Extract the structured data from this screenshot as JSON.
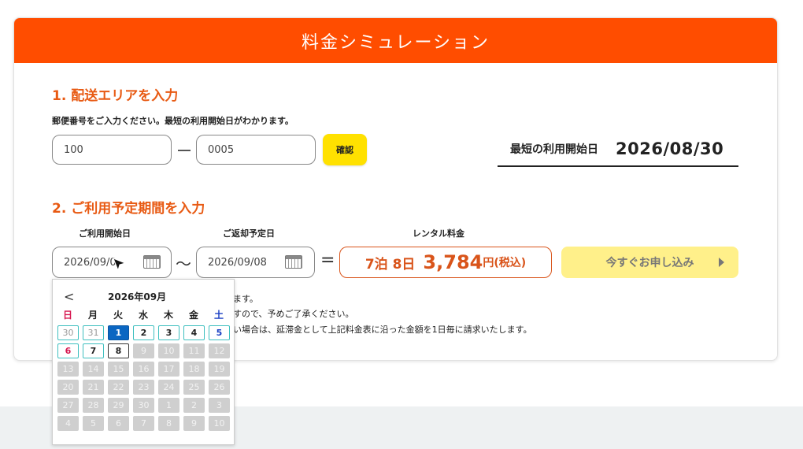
{
  "header": {
    "title": "料金シミュレーション"
  },
  "step1": {
    "title": "1. 配送エリアを入力",
    "note": "郵便番号をご入力ください。最短の利用開始日がわかります。",
    "zip_first": "100",
    "zip_second": "0005",
    "confirm_label": "確認",
    "earliest_label": "最短の利用開始日",
    "earliest_date": "2026/08/30"
  },
  "step2": {
    "title": "2. ご利用予定期間を入力",
    "start_label": "ご利用開始日",
    "return_label": "ご返却予定日",
    "fee_label": "レンタル料金",
    "start_date": "2026/09/0",
    "return_date": "2026/09/08",
    "tilde": "〜",
    "equals": "=",
    "price_nights": "7泊 8日",
    "price_amount": "3,784",
    "price_unit": "円(税込)",
    "apply_label": "今すぐお申し込み"
  },
  "notices": [
    "ます。",
    "すので、予めご了承ください。",
    "い場合は、延滞金として上記料金表に沿った金額を1日毎に請求いたします。"
  ],
  "calendar": {
    "prev": "<",
    "title": "2026年09月",
    "weekdays": [
      "日",
      "月",
      "火",
      "水",
      "木",
      "金",
      "土"
    ],
    "weeks": [
      [
        {
          "d": "30",
          "s": "outside"
        },
        {
          "d": "31",
          "s": "outside"
        },
        {
          "d": "1",
          "s": "selected"
        },
        {
          "d": "2",
          "s": "avail"
        },
        {
          "d": "3",
          "s": "avail"
        },
        {
          "d": "4",
          "s": "avail"
        },
        {
          "d": "5",
          "s": "avail"
        }
      ],
      [
        {
          "d": "6",
          "s": "avail"
        },
        {
          "d": "7",
          "s": "avail"
        },
        {
          "d": "8",
          "s": "end"
        },
        {
          "d": "9",
          "s": "disabled"
        },
        {
          "d": "10",
          "s": "disabled"
        },
        {
          "d": "11",
          "s": "disabled"
        },
        {
          "d": "12",
          "s": "disabled"
        }
      ],
      [
        {
          "d": "13",
          "s": "disabled"
        },
        {
          "d": "14",
          "s": "disabled"
        },
        {
          "d": "15",
          "s": "disabled"
        },
        {
          "d": "16",
          "s": "disabled"
        },
        {
          "d": "17",
          "s": "disabled"
        },
        {
          "d": "18",
          "s": "disabled"
        },
        {
          "d": "19",
          "s": "disabled"
        }
      ],
      [
        {
          "d": "20",
          "s": "disabled"
        },
        {
          "d": "21",
          "s": "disabled"
        },
        {
          "d": "22",
          "s": "disabled"
        },
        {
          "d": "23",
          "s": "disabled"
        },
        {
          "d": "24",
          "s": "disabled"
        },
        {
          "d": "25",
          "s": "disabled"
        },
        {
          "d": "26",
          "s": "disabled"
        }
      ],
      [
        {
          "d": "27",
          "s": "disabled"
        },
        {
          "d": "28",
          "s": "disabled"
        },
        {
          "d": "29",
          "s": "disabled"
        },
        {
          "d": "30",
          "s": "disabled"
        },
        {
          "d": "1",
          "s": "disabled"
        },
        {
          "d": "2",
          "s": "disabled"
        },
        {
          "d": "3",
          "s": "disabled"
        }
      ],
      [
        {
          "d": "4",
          "s": "disabled"
        },
        {
          "d": "5",
          "s": "disabled"
        },
        {
          "d": "6",
          "s": "disabled"
        },
        {
          "d": "7",
          "s": "disabled"
        },
        {
          "d": "8",
          "s": "disabled"
        },
        {
          "d": "9",
          "s": "disabled"
        },
        {
          "d": "10",
          "s": "disabled"
        }
      ]
    ]
  },
  "colors": {
    "header": "#ff4d00",
    "accent": "#e85a13",
    "confirm": "#ffe100",
    "apply": "#fff08a",
    "selected": "#0a66c2"
  }
}
